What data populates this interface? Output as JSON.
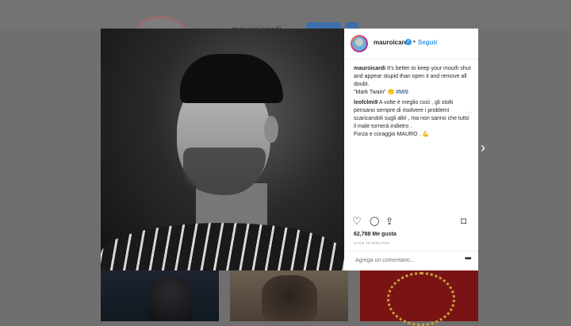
{
  "background": {
    "username": "mauroicardi"
  },
  "post": {
    "username": "mauroicardi",
    "verified_glyph": "✓",
    "separator": "•",
    "follow_label": "Seguir",
    "caption_user": "mauroicardi",
    "caption_text": "It's better to keep your mouth shut and appear stupid than open it and remove all doubt.",
    "caption_quote": "\"Mark Twain\" 😶 ",
    "caption_tag": "#MI9",
    "comment_user": "leofclmi9",
    "comment_text": "A volte è meglio così , gli stolti pensano sempre di risolvere i problemi scaricandoli sugli altri , ma non sanno che tutto il male tornerà indietro .",
    "comment_text2": "Forza e coraggio MAURO . 💪",
    "likes_count": "62,788",
    "likes_label": "Me gusta",
    "time_ago": "HACE 19 MINUTOS",
    "comment_placeholder": "Agrega un comentario...",
    "more_glyph": "•••"
  },
  "icons": {
    "heart": "♡",
    "comment": "◯",
    "share": "⇪",
    "bookmark": "⌑",
    "next": "›"
  }
}
